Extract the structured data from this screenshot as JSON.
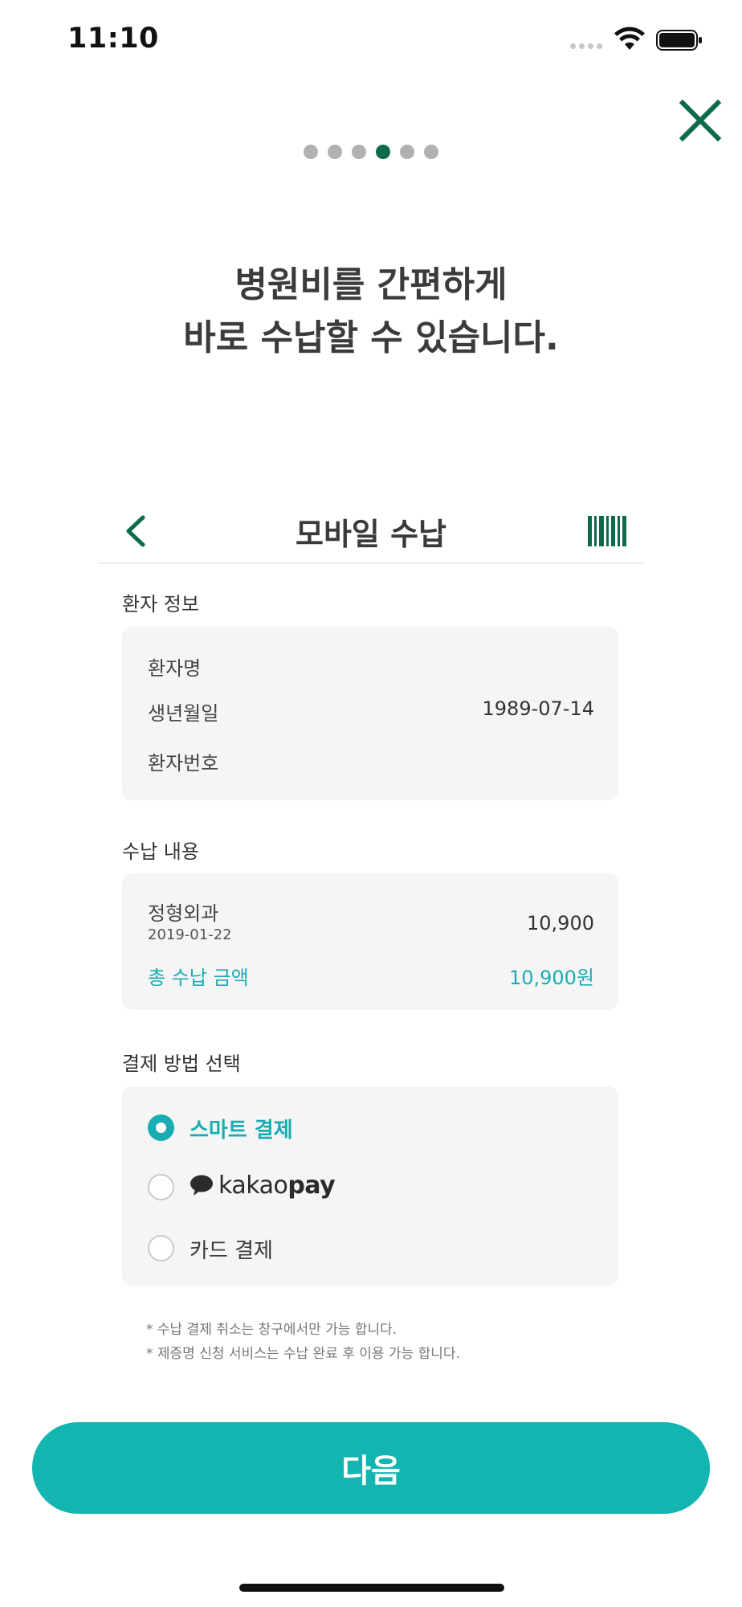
{
  "status_bar": {
    "time": "11:10"
  },
  "headline": {
    "line1": "병원비를 간편하게",
    "line2": "바로 수납할 수 있습니다."
  },
  "pager": {
    "total": 6,
    "current": 4
  },
  "preview": {
    "title": "모바일 수납",
    "patient_section": {
      "title": "환자 정보",
      "rows": [
        {
          "label": "환자명",
          "value": ""
        },
        {
          "label": "생년월일",
          "value": "1989-07-14"
        },
        {
          "label": "환자번호",
          "value": ""
        }
      ]
    },
    "payment_section": {
      "title": "수납 내용",
      "department": "정형외과",
      "date": "2019-01-22",
      "amount": "10,900",
      "total_label": "총 수납 금액",
      "total_value": "10,900원"
    },
    "method_section": {
      "title": "결제 방법 선택",
      "options": [
        {
          "label": "스마트 결제",
          "selected": true
        },
        {
          "label": "kakaopay",
          "logo_prefix": "kakao",
          "logo_suffix": "pay",
          "selected": false
        },
        {
          "label": "카드 결제",
          "selected": false
        }
      ]
    },
    "notes": [
      "* 수납 결제 취소는 창구에서만 가능 합니다.",
      "* 제증명 신청 서비스는 수납 완료 후 이용 가능 합니다."
    ]
  },
  "next_button": {
    "label": "다음"
  },
  "colors": {
    "accent": "#19adb3",
    "brand_green": "#0f6a4d",
    "button": "#12b5b0"
  },
  "icons": [
    "signal-icon",
    "wifi-icon",
    "battery-icon",
    "close-icon",
    "back-arrow-icon",
    "barcode-icon",
    "kakao-bubble-icon"
  ]
}
